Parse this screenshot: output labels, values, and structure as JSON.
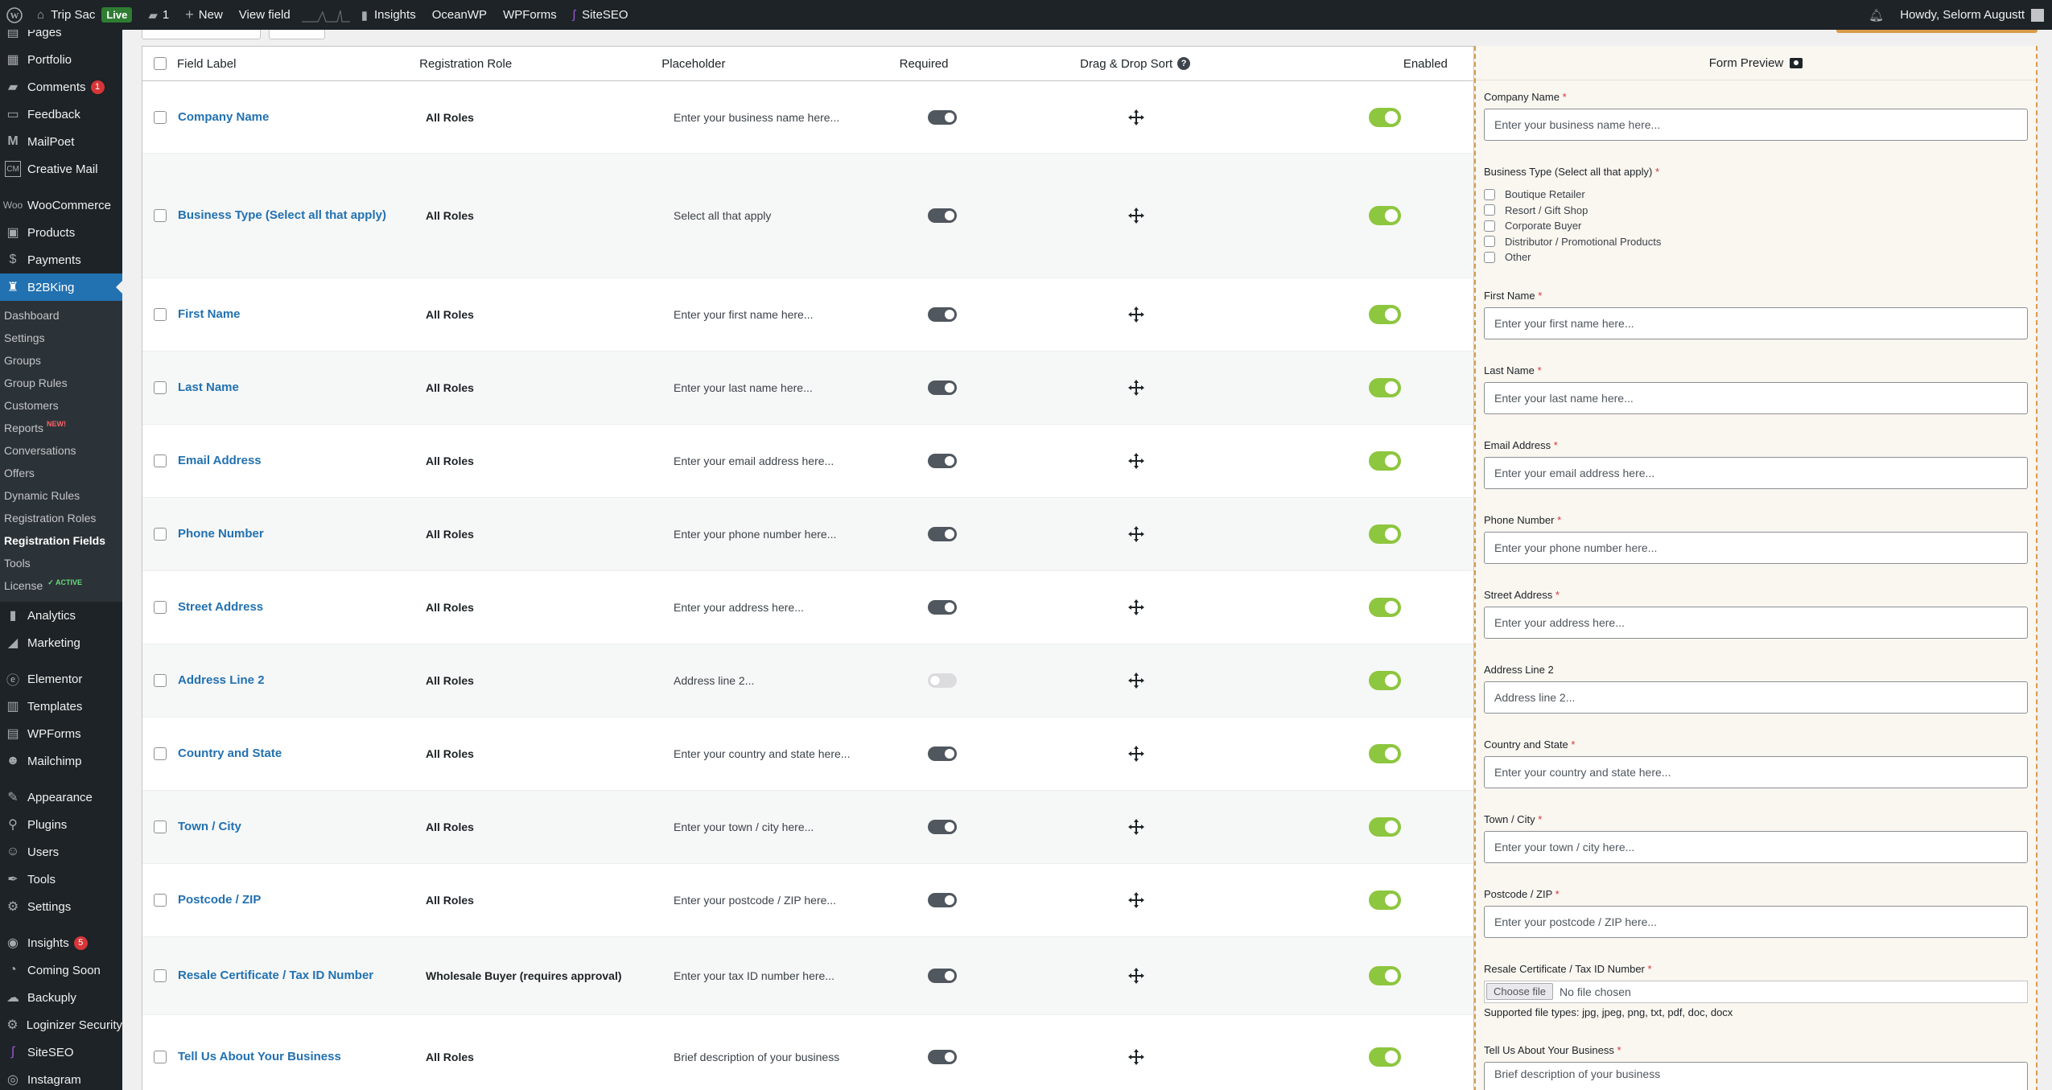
{
  "adminbar": {
    "site_name": "Trip Sac",
    "live_label": "Live",
    "comments_count": "1",
    "new_label": "New",
    "view_field_label": "View field",
    "insights_label": "Insights",
    "oceanwp_label": "OceanWP",
    "wpforms_label": "WPForms",
    "siteseo_label": "SiteSEO",
    "greeting": "Howdy, Selorm Augustt"
  },
  "sidebar": {
    "items": [
      {
        "label": "Pages",
        "icon": "pages-icon"
      },
      {
        "label": "Portfolio",
        "icon": "portfolio-icon"
      },
      {
        "label": "Comments",
        "icon": "comments-icon",
        "badge": "1"
      },
      {
        "label": "Feedback",
        "icon": "feedback-icon"
      },
      {
        "label": "MailPoet",
        "icon": "mailpoet-icon"
      },
      {
        "label": "Creative Mail",
        "icon": "creative-mail-icon"
      },
      {
        "label": "WooCommerce",
        "icon": "woocommerce-icon"
      },
      {
        "label": "Products",
        "icon": "products-icon"
      },
      {
        "label": "Payments",
        "icon": "payments-icon"
      },
      {
        "label": "B2BKing",
        "icon": "b2bking-icon"
      }
    ],
    "submenu": [
      {
        "label": "Dashboard"
      },
      {
        "label": "Settings"
      },
      {
        "label": "Groups"
      },
      {
        "label": "Group Rules"
      },
      {
        "label": "Customers"
      },
      {
        "label": "Reports",
        "tag": "NEW!"
      },
      {
        "label": "Conversations"
      },
      {
        "label": "Offers"
      },
      {
        "label": "Dynamic Rules"
      },
      {
        "label": "Registration Roles"
      },
      {
        "label": "Registration Fields"
      },
      {
        "label": "Tools"
      },
      {
        "label": "License",
        "tag": "✓ ACTIVE"
      }
    ],
    "items2": [
      {
        "label": "Analytics",
        "icon": "analytics-icon"
      },
      {
        "label": "Marketing",
        "icon": "marketing-icon"
      },
      {
        "label": "Elementor",
        "icon": "elementor-icon"
      },
      {
        "label": "Templates",
        "icon": "templates-icon"
      },
      {
        "label": "WPForms",
        "icon": "wpforms-icon"
      },
      {
        "label": "Mailchimp",
        "icon": "mailchimp-icon"
      },
      {
        "label": "Appearance",
        "icon": "appearance-icon"
      },
      {
        "label": "Plugins",
        "icon": "plugins-icon"
      },
      {
        "label": "Users",
        "icon": "users-icon"
      },
      {
        "label": "Tools",
        "icon": "tools-icon"
      },
      {
        "label": "Settings",
        "icon": "settings-icon"
      },
      {
        "label": "Insights",
        "icon": "insights-icon",
        "badge": "5"
      },
      {
        "label": "Coming Soon",
        "icon": "coming-soon-icon"
      },
      {
        "label": "Backuply",
        "icon": "backuply-icon"
      },
      {
        "label": "Loginizer Security",
        "icon": "loginizer-icon"
      },
      {
        "label": "SiteSEO",
        "icon": "siteseo-icon"
      },
      {
        "label": "Instagram",
        "icon": "instagram-icon"
      }
    ]
  },
  "table": {
    "headers": {
      "field_label": "Field Label",
      "role": "Registration Role",
      "placeholder": "Placeholder",
      "required": "Required",
      "drag": "Drag & Drop Sort",
      "enabled": "Enabled"
    },
    "rows": [
      {
        "label": "Company Name",
        "role": "All Roles",
        "placeholder": "Enter your business name here...",
        "required": true,
        "enabled": true
      },
      {
        "label": "Business Type (Select all that apply)",
        "role": "All Roles",
        "placeholder": "Select all that apply",
        "required": true,
        "enabled": true
      },
      {
        "label": "First Name",
        "role": "All Roles",
        "placeholder": "Enter your first name here...",
        "required": true,
        "enabled": true
      },
      {
        "label": "Last Name",
        "role": "All Roles",
        "placeholder": "Enter your last name here...",
        "required": true,
        "enabled": true
      },
      {
        "label": "Email Address",
        "role": "All Roles",
        "placeholder": "Enter your email address here...",
        "required": true,
        "enabled": true
      },
      {
        "label": "Phone Number",
        "role": "All Roles",
        "placeholder": "Enter your phone number here...",
        "required": true,
        "enabled": true
      },
      {
        "label": "Street Address",
        "role": "All Roles",
        "placeholder": "Enter your address here...",
        "required": true,
        "enabled": true
      },
      {
        "label": "Address Line 2",
        "role": "All Roles",
        "placeholder": "Address line 2...",
        "required": false,
        "enabled": true
      },
      {
        "label": "Country and State",
        "role": "All Roles",
        "placeholder": "Enter your country and state here...",
        "required": true,
        "enabled": true
      },
      {
        "label": "Town / City",
        "role": "All Roles",
        "placeholder": "Enter your town / city here...",
        "required": true,
        "enabled": true
      },
      {
        "label": "Postcode / ZIP",
        "role": "All Roles",
        "placeholder": "Enter your postcode / ZIP here...",
        "required": true,
        "enabled": true
      },
      {
        "label": "Resale Certificate / Tax ID Number",
        "role": "Wholesale Buyer (requires approval)",
        "placeholder": "Enter your tax ID number here...",
        "required": true,
        "enabled": true
      },
      {
        "label": "Tell Us About Your Business",
        "role": "All Roles",
        "placeholder": "Brief description of your business",
        "required": true,
        "enabled": true
      }
    ]
  },
  "preview": {
    "title": "Form Preview",
    "fields": [
      {
        "label": "Company Name",
        "required": true,
        "type": "text",
        "placeholder": "Enter your business name here..."
      },
      {
        "label": "Business Type (Select all that apply)",
        "required": true,
        "type": "checkbox",
        "options": [
          "Boutique Retailer",
          "Resort / Gift Shop",
          "Corporate Buyer",
          "Distributor / Promotional Products",
          "Other"
        ]
      },
      {
        "label": "First Name",
        "required": true,
        "type": "text",
        "placeholder": "Enter your first name here..."
      },
      {
        "label": "Last Name",
        "required": true,
        "type": "text",
        "placeholder": "Enter your last name here..."
      },
      {
        "label": "Email Address",
        "required": true,
        "type": "text",
        "placeholder": "Enter your email address here..."
      },
      {
        "label": "Phone Number",
        "required": true,
        "type": "text",
        "placeholder": "Enter your phone number here..."
      },
      {
        "label": "Street Address",
        "required": true,
        "type": "text",
        "placeholder": "Enter your address here..."
      },
      {
        "label": "Address Line 2",
        "required": false,
        "type": "text",
        "placeholder": "Address line 2..."
      },
      {
        "label": "Country and State",
        "required": true,
        "type": "text",
        "placeholder": "Enter your country and state here..."
      },
      {
        "label": "Town / City",
        "required": true,
        "type": "text",
        "placeholder": "Enter your town / city here..."
      },
      {
        "label": "Postcode / ZIP",
        "required": true,
        "type": "text",
        "placeholder": "Enter your postcode / ZIP here..."
      },
      {
        "label": "Resale Certificate / Tax ID Number",
        "required": true,
        "type": "file",
        "button": "Choose file",
        "status": "No file chosen",
        "note": "Supported file types: jpg, jpeg, png, txt, pdf, doc, docx"
      },
      {
        "label": "Tell Us About Your Business",
        "required": true,
        "type": "textarea",
        "placeholder": "Brief description of your business"
      }
    ]
  },
  "colors": {
    "admin_dark": "#1d2327",
    "accent_blue": "#2271b1",
    "toggle_green": "#8dc63f",
    "preview_border": "#d89c4a"
  }
}
